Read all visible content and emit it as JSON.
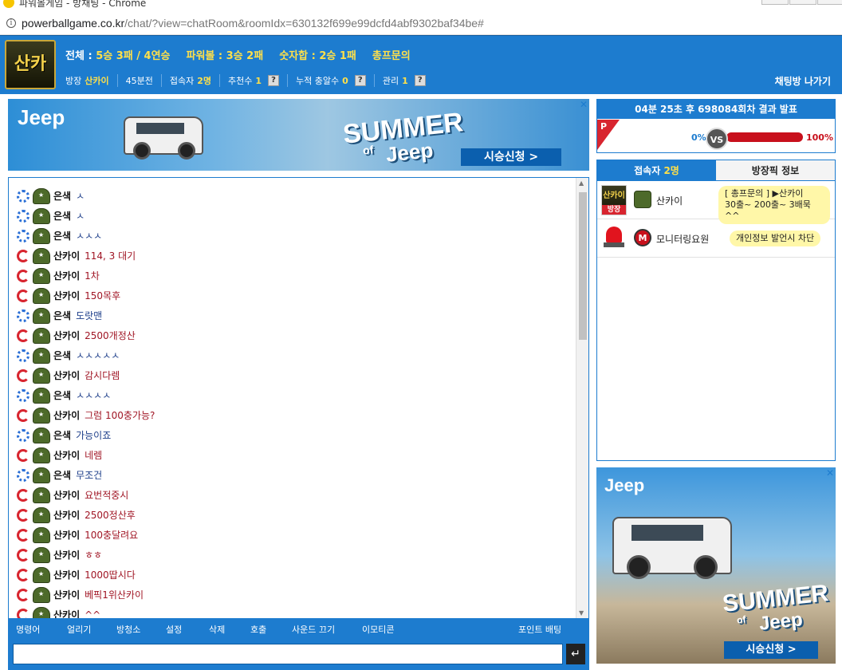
{
  "browser": {
    "title": "파워볼게임 - 방채팅 - Chrome",
    "url_host": "powerballgame.co.kr",
    "url_path": "/chat/?view=chatRoom&roomIdx=630132f699e99dcfd4abf9302baf34be#"
  },
  "header": {
    "logo_text": "산카이",
    "stats": {
      "total_label": "전체 :",
      "total_value": "5승 3패 / 4연승",
      "powerball_label": "파워볼 :",
      "powerball_value": "3승 2패",
      "sum_label": "숫자합 :",
      "sum_value": "2승 1패",
      "inquiry": "총프문의"
    },
    "info": {
      "host_label": "방장",
      "host_name": "산카이",
      "duration": "45분전",
      "users_label": "접속자",
      "users_value": "2명",
      "recommend_label": "추천수",
      "recommend_value": "1",
      "cumulative_label": "누적 충알수",
      "cumulative_value": "0",
      "manage_label": "관리",
      "manage_value": "1",
      "help": "?"
    },
    "exit_label": "채팅방 나가기"
  },
  "ad": {
    "brand": "Jeep",
    "summer": "SUMMER",
    "of": "of",
    "summer_brand": "Jeep",
    "cta": "시승신청 >",
    "choices_icon": "info-icon",
    "close": "✕"
  },
  "chat": {
    "messages": [
      {
        "user": "은색",
        "text": "ㅅ",
        "color": "blue"
      },
      {
        "user": "은색",
        "text": "ㅅ",
        "color": "blue"
      },
      {
        "user": "은색",
        "text": "ㅅㅅㅅ",
        "color": "blue"
      },
      {
        "user": "산카이",
        "text": "114, 3 대기",
        "color": "red"
      },
      {
        "user": "산카이",
        "text": "1차",
        "color": "red"
      },
      {
        "user": "산카이",
        "text": "150목후",
        "color": "red"
      },
      {
        "user": "은색",
        "text": "도랏맨",
        "color": "blue"
      },
      {
        "user": "산카이",
        "text": "2500개정산",
        "color": "red"
      },
      {
        "user": "은색",
        "text": "ㅅㅅㅅㅅㅅ",
        "color": "blue"
      },
      {
        "user": "산카이",
        "text": "감시다렘",
        "color": "red"
      },
      {
        "user": "은색",
        "text": "ㅅㅅㅅㅅ",
        "color": "blue"
      },
      {
        "user": "산카이",
        "text": "그럼 100충가능?",
        "color": "red"
      },
      {
        "user": "은색",
        "text": "가능이죠",
        "color": "blue"
      },
      {
        "user": "산카이",
        "text": "네렘",
        "color": "red"
      },
      {
        "user": "은색",
        "text": "무조건",
        "color": "blue"
      },
      {
        "user": "산카이",
        "text": "요번적중시",
        "color": "red"
      },
      {
        "user": "산카이",
        "text": "2500정산후",
        "color": "red"
      },
      {
        "user": "산카이",
        "text": "100충달려요",
        "color": "red"
      },
      {
        "user": "산카이",
        "text": "ㅎㅎ",
        "color": "red"
      },
      {
        "user": "산카이",
        "text": "1000땁시다",
        "color": "red"
      },
      {
        "user": "산카이",
        "text": "베픽1위산카이",
        "color": "red"
      },
      {
        "user": "산카이",
        "text": "^^",
        "color": "red"
      }
    ]
  },
  "toolbar": {
    "items": [
      "명령어",
      "얼리기",
      "방청소",
      "설정",
      "삭제",
      "호출",
      "사운드 끄기",
      "이모티콘"
    ],
    "point_bet": "포인트 배팅"
  },
  "input": {
    "send_icon": "↵"
  },
  "result": {
    "title": "04분 25초 후 698084회차 결과 발표",
    "p_label": "P",
    "left_pct": "0%",
    "vs": "VS",
    "right_pct": "100%",
    "bar_fill": 1.0
  },
  "users_panel": {
    "tab_users_label": "접속자",
    "tab_users_count": "2명",
    "tab_pick_label": "방장픽 정보",
    "rows": [
      {
        "name": "산카이",
        "badge": "방장",
        "pic_text": "산카이",
        "bubble": "[ 총프문의 ] ▶산카이\n30출~ 200출~ 3배묵 ^^"
      },
      {
        "name": "모니터링요원",
        "avatar_letter": "M",
        "bubble": "개인정보 발언시 차단"
      }
    ]
  },
  "colors": {
    "primary": "#1d7ccf",
    "accent_yellow": "#ffe04a",
    "red": "#c8101c"
  }
}
